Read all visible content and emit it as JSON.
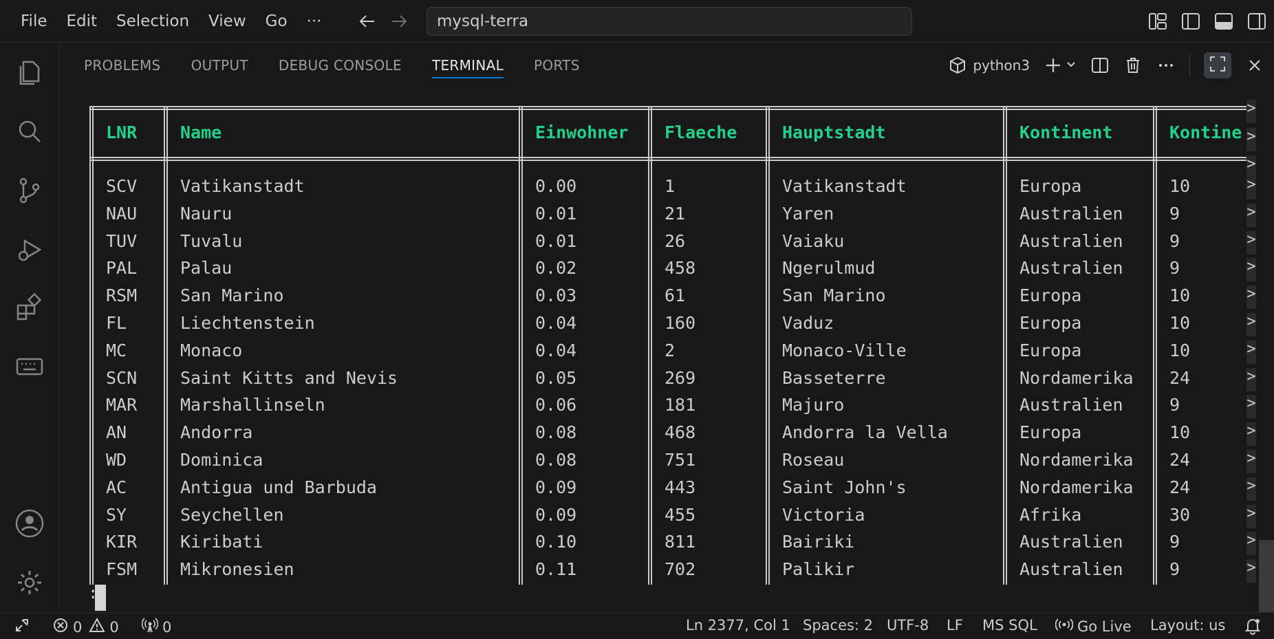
{
  "menu": [
    "File",
    "Edit",
    "Selection",
    "View",
    "Go",
    "···"
  ],
  "command_center": "mysql-terra",
  "panel_tabs": [
    "PROBLEMS",
    "OUTPUT",
    "DEBUG CONSOLE",
    "TERMINAL",
    "PORTS"
  ],
  "active_tab": "TERMINAL",
  "terminal_profile": "python3",
  "table": {
    "headers": [
      "LNR",
      "Name",
      "Einwohner",
      "Flaeche",
      "Hauptstadt",
      "Kontinent",
      "Kontine"
    ],
    "rows": [
      [
        "SCV",
        "Vatikanstadt",
        "0.00",
        "1",
        "Vatikanstadt",
        "Europa",
        "10"
      ],
      [
        "NAU",
        "Nauru",
        "0.01",
        "21",
        "Yaren",
        "Australien",
        "9"
      ],
      [
        "TUV",
        "Tuvalu",
        "0.01",
        "26",
        "Vaiaku",
        "Australien",
        "9"
      ],
      [
        "PAL",
        "Palau",
        "0.02",
        "458",
        "Ngerulmud",
        "Australien",
        "9"
      ],
      [
        "RSM",
        "San Marino",
        "0.03",
        "61",
        "San Marino",
        "Europa",
        "10"
      ],
      [
        "FL",
        "Liechtenstein",
        "0.04",
        "160",
        "Vaduz",
        "Europa",
        "10"
      ],
      [
        "MC",
        "Monaco",
        "0.04",
        "2",
        "Monaco-Ville",
        "Europa",
        "10"
      ],
      [
        "SCN",
        "Saint Kitts and Nevis",
        "0.05",
        "269",
        "Basseterre",
        "Nordamerika",
        "24"
      ],
      [
        "MAR",
        "Marshallinseln",
        "0.06",
        "181",
        "Majuro",
        "Australien",
        "9"
      ],
      [
        "AN",
        "Andorra",
        "0.08",
        "468",
        "Andorra la Vella",
        "Europa",
        "10"
      ],
      [
        "WD",
        "Dominica",
        "0.08",
        "751",
        "Roseau",
        "Nordamerika",
        "24"
      ],
      [
        "AC",
        "Antigua und Barbuda",
        "0.09",
        "443",
        "Saint John's",
        "Nordamerika",
        "24"
      ],
      [
        "SY",
        "Seychellen",
        "0.09",
        "455",
        "Victoria",
        "Afrika",
        "30"
      ],
      [
        "KIR",
        "Kiribati",
        "0.10",
        "811",
        "Bairiki",
        "Australien",
        "9"
      ],
      [
        "FSM",
        "Mikronesien",
        "0.11",
        "702",
        "Palikir",
        "Australien",
        "9"
      ]
    ],
    "overflow_marker": ">"
  },
  "pager_prompt": ":",
  "status": {
    "errors": "0",
    "warnings": "0",
    "ports": "0",
    "position": "Ln 2377, Col 1",
    "spaces": "Spaces: 2",
    "encoding": "UTF-8",
    "eol": "LF",
    "language": "MS SQL",
    "golive": "Go Live",
    "layout": "Layout: us"
  },
  "colors": {
    "header_text": "#23d18b",
    "accent": "#0078d4",
    "background": "#181818"
  }
}
